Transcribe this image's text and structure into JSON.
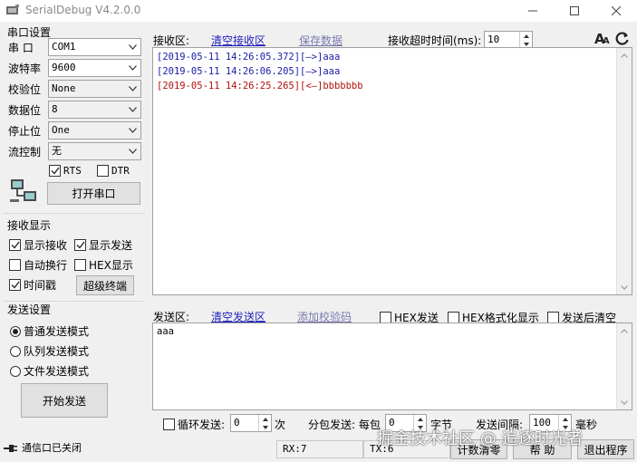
{
  "window": {
    "title": "SerialDebug V4.2.0.0",
    "minimize_icon": "minimize-icon",
    "maximize_icon": "maximize-icon",
    "close_icon": "close-icon"
  },
  "serial_settings": {
    "title": "串口设置",
    "port": {
      "label": "串  口",
      "value": "COM1"
    },
    "baud": {
      "label": "波特率",
      "value": "9600"
    },
    "parity": {
      "label": "校验位",
      "value": "None"
    },
    "databits": {
      "label": "数据位",
      "value": "8"
    },
    "stopbits": {
      "label": "停止位",
      "value": "One"
    },
    "flow": {
      "label": "流控制",
      "value": "无"
    },
    "rts": {
      "label": "RTS",
      "checked": true
    },
    "dtr": {
      "label": "DTR",
      "checked": false
    },
    "open_button": "打开串口"
  },
  "receive_display": {
    "title": "接收显示",
    "show_recv": {
      "label": "显示接收",
      "checked": true
    },
    "show_send": {
      "label": "显示发送",
      "checked": true
    },
    "auto_wrap": {
      "label": "自动换行",
      "checked": false
    },
    "hex_display": {
      "label": "HEX显示",
      "checked": false
    },
    "timestamp": {
      "label": "时间戳",
      "checked": true
    },
    "terminal_button": "超级终端"
  },
  "send_settings": {
    "title": "发送设置",
    "modes": [
      {
        "label": "普通发送模式",
        "selected": true
      },
      {
        "label": "队列发送模式",
        "selected": false
      },
      {
        "label": "文件发送模式",
        "selected": false
      }
    ],
    "start_button": "开始发送"
  },
  "receive_area": {
    "label": "接收区:",
    "clear_link": "清空接收区",
    "save_link": "保存数据",
    "timeout_label": "接收超时时间(ms):",
    "timeout_value": "10",
    "lines": [
      {
        "text": "[2019-05-11 14:26:05.372][—>]aaa",
        "color": "#1a1aa6"
      },
      {
        "text": "[2019-05-11 14:26:06.205][—>]aaa",
        "color": "#1a1aa6"
      },
      {
        "text": "[2019-05-11 14:26:25.265][<—]bbbbbbb",
        "color": "#b01010"
      }
    ]
  },
  "send_area": {
    "label": "发送区:",
    "clear_link": "清空发送区",
    "checksum_link": "添加校验码",
    "hex_send": {
      "label": "HEX发送",
      "checked": false
    },
    "hex_format": {
      "label": "HEX格式化显示",
      "checked": false
    },
    "clear_after": {
      "label": "发送后清空",
      "checked": false
    },
    "content": "aaa"
  },
  "bottom_bar": {
    "loop_send": {
      "label": "循环发送:",
      "checked": false,
      "value": "0",
      "unit": "次"
    },
    "packet": {
      "label": "分包发送: 每包",
      "value": "0",
      "unit": "字节"
    },
    "interval": {
      "label": "发送间隔:",
      "value": "100",
      "unit": "毫秒"
    }
  },
  "status_bar": {
    "port_status": "通信口已关闭",
    "rx": "RX:7",
    "tx": "TX:6",
    "clear_count": "计数清零",
    "help": "帮 助",
    "exit": "退出程序"
  },
  "watermark": "掘金技术社区 @ 追逐时光者",
  "colors": {
    "link": "#1f1fbf",
    "link_disabled": "#7a7ab0",
    "send_line": "#1a1aa6",
    "recv_line": "#b01010"
  }
}
